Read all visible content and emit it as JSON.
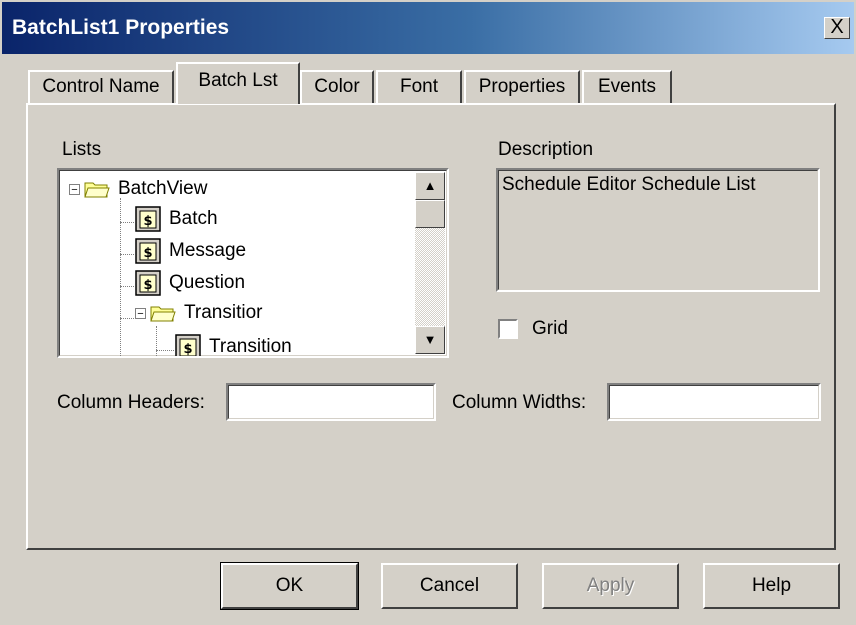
{
  "window": {
    "title": "BatchList1 Properties",
    "close_glyph": "X"
  },
  "tabs": [
    {
      "label": "Control Name",
      "active": false
    },
    {
      "label": "Batch Lst",
      "active": true
    },
    {
      "label": "Color",
      "active": false
    },
    {
      "label": "Font",
      "active": false
    },
    {
      "label": "Properties",
      "active": false
    },
    {
      "label": "Events",
      "active": false
    }
  ],
  "lists": {
    "label": "Lists",
    "items": [
      {
        "label": "BatchView",
        "icon": "folder-icon",
        "expander": "−"
      },
      {
        "label": "Batch",
        "icon": "document-icon"
      },
      {
        "label": "Message",
        "icon": "document-icon"
      },
      {
        "label": "Question",
        "icon": "document-icon"
      },
      {
        "label": "Transitior",
        "icon": "folder-icon",
        "expander": "−"
      },
      {
        "label": "Transition",
        "icon": "document-icon"
      }
    ],
    "scroll_up_glyph": "▲",
    "scroll_down_glyph": "▼"
  },
  "description": {
    "label": "Description",
    "value": "Schedule Editor Schedule List"
  },
  "grid": {
    "label": "Grid",
    "checked": false
  },
  "column_headers": {
    "label": "Column Headers:",
    "value": ""
  },
  "column_widths": {
    "label": "Column Widths:",
    "value": ""
  },
  "buttons": {
    "ok": "OK",
    "cancel": "Cancel",
    "apply": "Apply",
    "help": "Help"
  },
  "colors": {
    "title_gradient_start": "#0a246a",
    "title_gradient_end": "#a6caf0",
    "face": "#d4d0c8"
  }
}
